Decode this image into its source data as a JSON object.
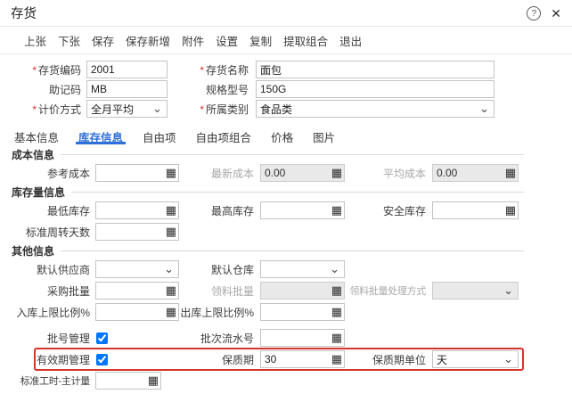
{
  "window": {
    "title": "存货"
  },
  "icons": {
    "calculator": "▦",
    "chevron_down": "⌄",
    "help": "?",
    "close": "✕"
  },
  "required_marker": "*",
  "colors": {
    "accent_blue": "#2e6fd8",
    "highlight_red": "#d5342b",
    "required_red": "#e03131"
  },
  "toolbar": {
    "items": [
      "上张",
      "下张",
      "保存",
      "保存新增",
      "附件",
      "设置",
      "复制",
      "提取组合",
      "退出"
    ]
  },
  "tabs": {
    "items": [
      "基本信息",
      "库存信息",
      "自由项",
      "自由项组合",
      "价格",
      "图片"
    ],
    "active": "库存信息"
  },
  "sections": {
    "cost": "成本信息",
    "stock": "库存量信息",
    "other": "其他信息"
  },
  "fields": {
    "code": {
      "label": "存货编码",
      "value": "2001",
      "required": true
    },
    "name": {
      "label": "存货名称",
      "value": "面包",
      "required": true
    },
    "mnemonic": {
      "label": "助记码",
      "value": "MB"
    },
    "spec": {
      "label": "规格型号",
      "value": "150G"
    },
    "pricing": {
      "label": "计价方式",
      "value": "全月平均",
      "required": true
    },
    "category": {
      "label": "所属类别",
      "value": "食品类",
      "required": true
    },
    "ref_cost": {
      "label": "参考成本",
      "value": ""
    },
    "latest_cost": {
      "label": "最新成本",
      "value": "0.00",
      "disabled": true
    },
    "avg_cost": {
      "label": "平均成本",
      "value": "0.00",
      "disabled": true
    },
    "min_stock": {
      "label": "最低库存",
      "value": ""
    },
    "max_stock": {
      "label": "最高库存",
      "value": ""
    },
    "safe_stock": {
      "label": "安全库存",
      "value": ""
    },
    "turnover_days": {
      "label": "标准周转天数",
      "value": ""
    },
    "default_supplier": {
      "label": "默认供应商",
      "value": ""
    },
    "default_warehouse": {
      "label": "默认仓库",
      "value": ""
    },
    "purchase_batch": {
      "label": "采购批量",
      "value": ""
    },
    "picking_batch": {
      "label": "领料批量",
      "value": "",
      "disabled": true
    },
    "picking_batch_method": {
      "label": "领料批量处理方式",
      "value": "",
      "disabled": true
    },
    "inbound_limit": {
      "label": "入库上限比例%",
      "value": ""
    },
    "outbound_limit": {
      "label": "出库上限比例%",
      "value": ""
    },
    "batch_mgmt": {
      "label": "批号管理",
      "checked": true
    },
    "batch_serial": {
      "label": "批次流水号",
      "value": ""
    },
    "validity_mgmt": {
      "label": "有效期管理",
      "checked": true
    },
    "shelf_life": {
      "label": "保质期",
      "value": "30"
    },
    "shelf_life_unit": {
      "label": "保质期单位",
      "value": "天"
    },
    "std_hours": {
      "label": "标准工时-主计量",
      "value": ""
    }
  }
}
